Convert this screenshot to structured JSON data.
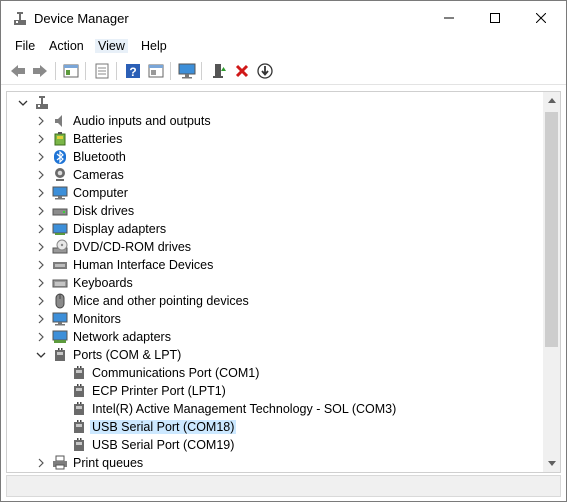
{
  "window": {
    "title": "Device Manager"
  },
  "menu": [
    "File",
    "Action",
    "View",
    "Help"
  ],
  "toolbar": {
    "icons": [
      "back-icon",
      "forward-icon",
      "properties-grid-icon",
      "list-icon",
      "help-icon",
      "view-pane-icon",
      "monitor-scan-icon",
      "update-driver-icon",
      "uninstall-icon",
      "download-icon"
    ]
  },
  "tree": {
    "root": {
      "label": ""
    },
    "categories": [
      {
        "label": "Audio inputs and outputs",
        "icon": "speaker-icon",
        "expanded": false
      },
      {
        "label": "Batteries",
        "icon": "battery-icon",
        "expanded": false
      },
      {
        "label": "Bluetooth",
        "icon": "bluetooth-icon",
        "expanded": false
      },
      {
        "label": "Cameras",
        "icon": "camera-icon",
        "expanded": false
      },
      {
        "label": "Computer",
        "icon": "computer-icon",
        "expanded": false
      },
      {
        "label": "Disk drives",
        "icon": "disk-icon",
        "expanded": false
      },
      {
        "label": "Display adapters",
        "icon": "display-adapter-icon",
        "expanded": false
      },
      {
        "label": "DVD/CD-ROM drives",
        "icon": "dvd-icon",
        "expanded": false
      },
      {
        "label": "Human Interface Devices",
        "icon": "hid-icon",
        "expanded": false
      },
      {
        "label": "Keyboards",
        "icon": "keyboard-icon",
        "expanded": false
      },
      {
        "label": "Mice and other pointing devices",
        "icon": "mouse-icon",
        "expanded": false
      },
      {
        "label": "Monitors",
        "icon": "monitor-icon",
        "expanded": false
      },
      {
        "label": "Network adapters",
        "icon": "network-icon",
        "expanded": false
      },
      {
        "label": "Ports (COM & LPT)",
        "icon": "port-icon",
        "expanded": true,
        "children": [
          {
            "label": "Communications Port (COM1)",
            "selected": false
          },
          {
            "label": "ECP Printer Port (LPT1)",
            "selected": false
          },
          {
            "label": "Intel(R) Active Management Technology - SOL (COM3)",
            "selected": false
          },
          {
            "label": "USB Serial Port (COM18)",
            "selected": true
          },
          {
            "label": "USB Serial Port (COM19)",
            "selected": false
          }
        ]
      },
      {
        "label": "Print queues",
        "icon": "printer-icon",
        "expanded": false
      }
    ]
  },
  "colors": {
    "selection": "#cce8ff",
    "accent": "#1e74d6"
  }
}
